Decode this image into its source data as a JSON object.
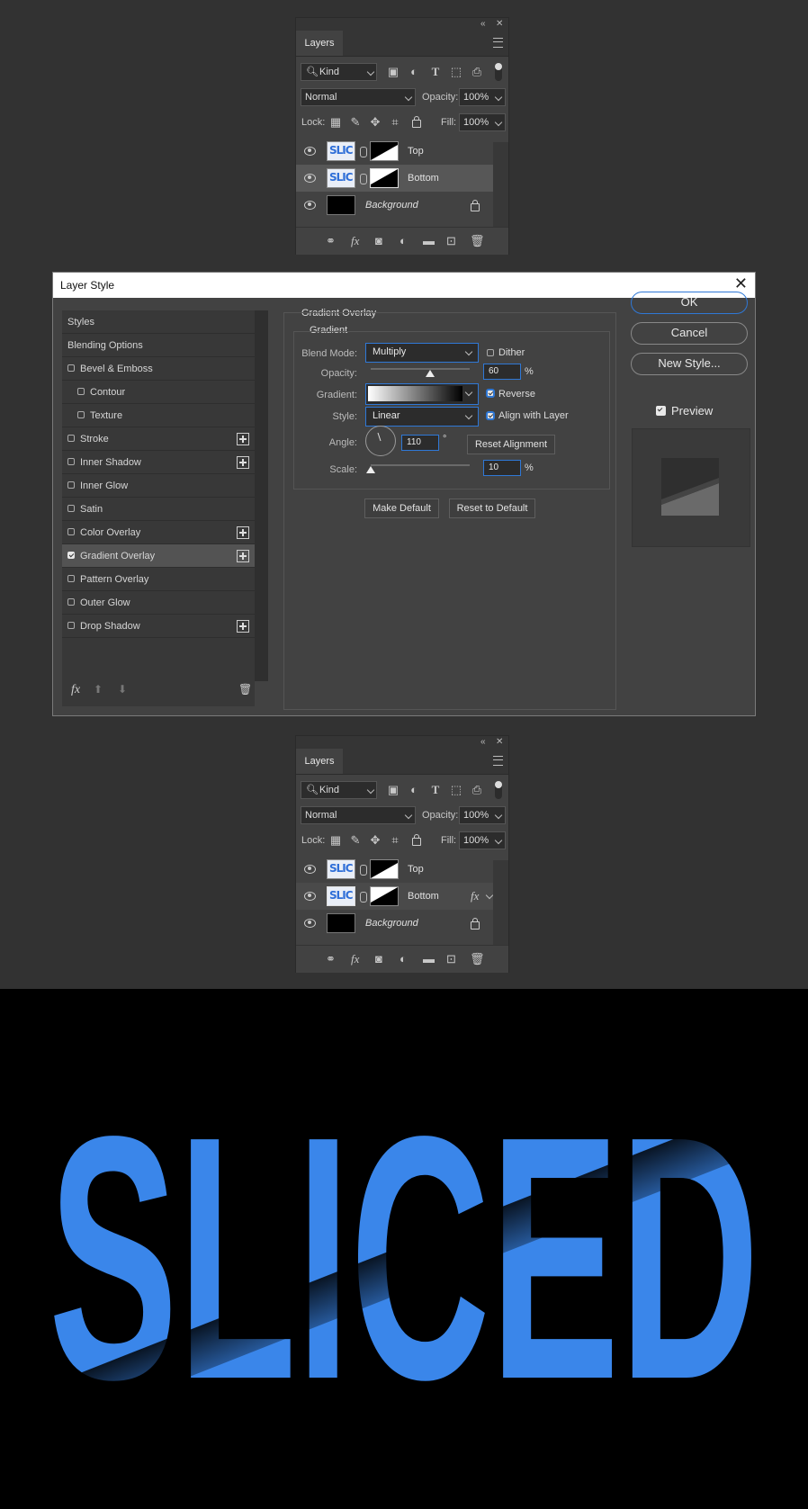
{
  "layers_panel_1": {
    "tab": "Layers",
    "filter": "Kind",
    "blend_mode": "Normal",
    "opacity_label": "Opacity:",
    "opacity": "100%",
    "lock_label": "Lock:",
    "fill_label": "Fill:",
    "fill": "100%",
    "layers": [
      {
        "name": "Top",
        "thumb_text": "SLIC"
      },
      {
        "name": "Bottom",
        "thumb_text": "SLIC"
      },
      {
        "name": "Background"
      }
    ]
  },
  "layers_panel_2": {
    "tab": "Layers",
    "filter": "Kind",
    "blend_mode": "Normal",
    "opacity_label": "Opacity:",
    "opacity": "100%",
    "lock_label": "Lock:",
    "fill_label": "Fill:",
    "fill": "100%",
    "fx": "fx",
    "layers": [
      {
        "name": "Top",
        "thumb_text": "SLIC"
      },
      {
        "name": "Bottom",
        "thumb_text": "SLIC"
      },
      {
        "name": "Background"
      }
    ]
  },
  "dialog": {
    "title": "Layer Style",
    "styles": [
      {
        "label": "Styles"
      },
      {
        "label": "Blending Options"
      },
      {
        "label": "Bevel & Emboss"
      },
      {
        "label": "Contour"
      },
      {
        "label": "Texture"
      },
      {
        "label": "Stroke"
      },
      {
        "label": "Inner Shadow"
      },
      {
        "label": "Inner Glow"
      },
      {
        "label": "Satin"
      },
      {
        "label": "Color Overlay"
      },
      {
        "label": "Gradient Overlay"
      },
      {
        "label": "Pattern Overlay"
      },
      {
        "label": "Outer Glow"
      },
      {
        "label": "Drop Shadow"
      }
    ],
    "section_title": "Gradient Overlay",
    "group_title": "Gradient",
    "blend_mode_label": "Blend Mode:",
    "blend_mode": "Multiply",
    "dither_label": "Dither",
    "opacity_label": "Opacity:",
    "opacity": "60",
    "opacity_value": 60,
    "percent": "%",
    "gradient_label": "Gradient:",
    "reverse_label": "Reverse",
    "style_label": "Style:",
    "style": "Linear",
    "align_label": "Align with Layer",
    "angle_label": "Angle:",
    "angle": "110",
    "degree": "°",
    "reset_alignment": "Reset Alignment",
    "scale_label": "Scale:",
    "scale": "10",
    "scale_value": 10,
    "make_default": "Make Default",
    "reset_default": "Reset to Default",
    "ok": "OK",
    "cancel": "Cancel",
    "new_style": "New Style...",
    "preview_label": "Preview",
    "fx": "fx"
  },
  "canvas": {
    "text": "SLICED",
    "text_color": "#3a86ea"
  }
}
